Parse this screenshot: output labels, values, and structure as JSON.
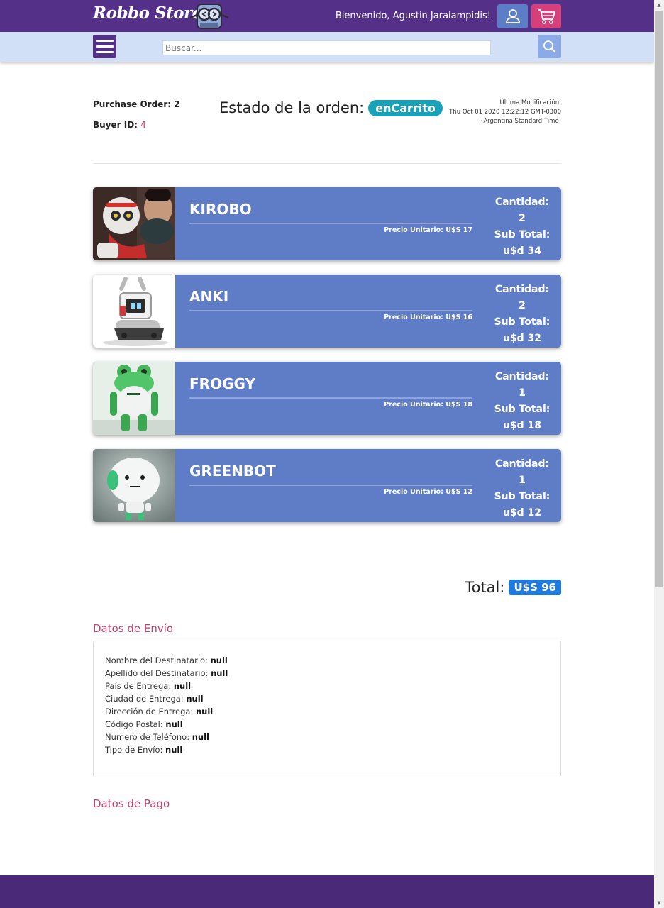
{
  "header": {
    "logo_text": "Robbo Store",
    "welcome": "Bienvenido, Agustin Jaralampidis!",
    "colors": {
      "bar": "#553088",
      "user_button": "#5b7ec6",
      "cart_button": "#d6407a"
    },
    "icons": {
      "user": "user-icon",
      "cart": "cart-icon",
      "logo": "robot-glasses-logo"
    }
  },
  "search": {
    "placeholder": "Buscar...",
    "value": "",
    "icons": {
      "menu": "hamburger-icon",
      "search": "search-icon"
    }
  },
  "order": {
    "purchase_order_label": "Purchase Order:",
    "purchase_order_value": "2",
    "buyer_id_label": "Buyer ID:",
    "buyer_id_value": "4",
    "status_label": "Estado de la orden:",
    "status_value": "enCarrito",
    "modified_label": "Última Modificación:",
    "modified_value": "Thu Oct 01 2020 12:22:12 GMT-0300",
    "modified_tz": "(Argentina Standard Time)"
  },
  "products": [
    {
      "name": "KIROBO",
      "unit_price": "Precio Unitario: U$S 17",
      "qty_label": "Cantidad:",
      "qty": "2",
      "subtotal_label": "Sub Total:",
      "subtotal": "u$d 34",
      "image": "kirobo-robot-photo"
    },
    {
      "name": "ANKI",
      "unit_price": "Precio Unitario: U$S 16",
      "qty_label": "Cantidad:",
      "qty": "2",
      "subtotal_label": "Sub Total:",
      "subtotal": "u$d 32",
      "image": "anki-cozmo-robot-photo"
    },
    {
      "name": "FROGGY",
      "unit_price": "Precio Unitario: U$S 18",
      "qty_label": "Cantidad:",
      "qty": "1",
      "subtotal_label": "Sub Total:",
      "subtotal": "u$d 18",
      "image": "green-frog-robot-photo"
    },
    {
      "name": "GREENBOT",
      "unit_price": "Precio Unitario: U$S 12",
      "qty_label": "Cantidad:",
      "qty": "1",
      "subtotal_label": "Sub Total:",
      "subtotal": "u$d 12",
      "image": "white-green-robot-photo"
    }
  ],
  "total": {
    "label": "Total:",
    "value": "U$S 96"
  },
  "shipping": {
    "title": "Datos de Envío",
    "fields": [
      {
        "label": "Nombre del Destinatario:",
        "value": "null"
      },
      {
        "label": "Apellido del Destinatario:",
        "value": "null"
      },
      {
        "label": "País de Entrega:",
        "value": "null"
      },
      {
        "label": "Ciudad de Entrega:",
        "value": "null"
      },
      {
        "label": "Dirección de Entrega:",
        "value": "null"
      },
      {
        "label": "Código Postal:",
        "value": "null"
      },
      {
        "label": "Numero de Teléfono:",
        "value": "null"
      },
      {
        "label": "Tipo de Envío:",
        "value": "null"
      }
    ]
  },
  "payment": {
    "title": "Datos de Pago"
  }
}
